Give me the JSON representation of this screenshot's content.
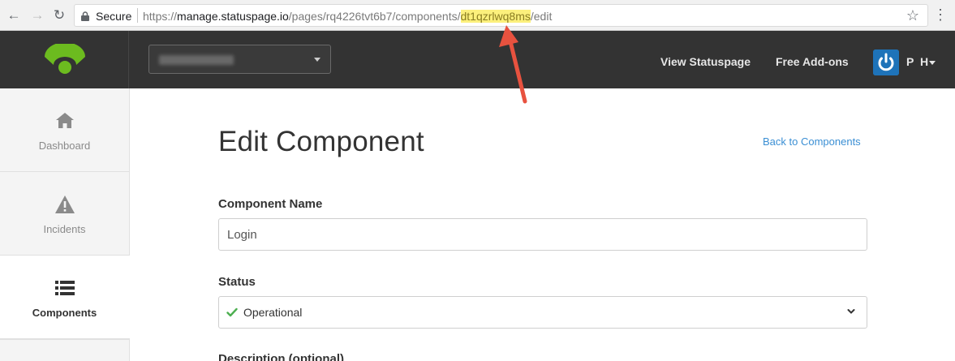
{
  "browser": {
    "secure_label": "Secure",
    "url_prefix": "https://",
    "url_host": "manage.statuspage.io",
    "url_path": "/pages/rq4226tvt6b7/components/",
    "url_highlight": "dt1qzrlwq8ms",
    "url_suffix": "/edit"
  },
  "header": {
    "view_statuspage": "View Statuspage",
    "free_addons": "Free Add-ons",
    "user_initials": "P H"
  },
  "sidebar": {
    "items": [
      {
        "label": "Dashboard",
        "icon": "home-icon"
      },
      {
        "label": "Incidents",
        "icon": "warning-icon"
      },
      {
        "label": "Components",
        "icon": "list-icon"
      }
    ]
  },
  "main": {
    "title": "Edit Component",
    "back_link": "Back to Components",
    "name_label": "Component Name",
    "name_value": "Login",
    "status_label": "Status",
    "status_value": "Operational",
    "description_label": "Description (optional)"
  },
  "colors": {
    "header_bg": "#333333",
    "logo_green": "#6cbb1f",
    "link_blue": "#3b8fd4",
    "status_green": "#4caf50",
    "avatar_blue": "#1e73b9",
    "annotation_red": "#e8523f",
    "url_highlight": "#fcf07c"
  }
}
